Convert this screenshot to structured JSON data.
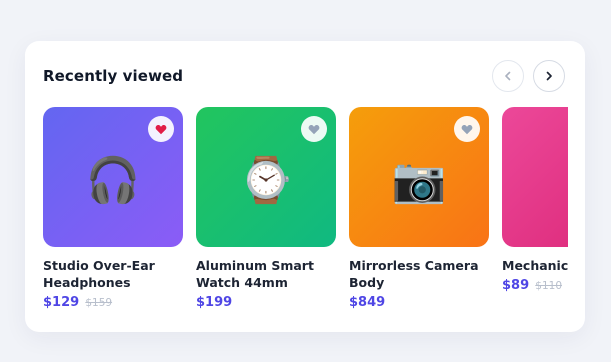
{
  "section": {
    "title": "Recently viewed",
    "prev_icon": "chevron-left-icon",
    "next_icon": "chevron-right-icon"
  },
  "colors": {
    "price": "#4f46e5",
    "old_price": "#b8bfcc",
    "favorite_active": "#e11d48",
    "favorite_inactive": "#94a3b8"
  },
  "products": [
    {
      "name": "Studio Over-Ear Headphones",
      "price": "$129",
      "old_price": "$159",
      "icon": "headphones-icon",
      "glyph": "🎧",
      "favorited": true,
      "gradient": [
        "#6366f1",
        "#8b5cf6"
      ]
    },
    {
      "name": "Aluminum Smart Watch 44mm",
      "price": "$199",
      "old_price": "",
      "icon": "watch-icon",
      "glyph": "⌚",
      "favorited": false,
      "gradient": [
        "#22c55e",
        "#10b981"
      ]
    },
    {
      "name": "Mirrorless Camera Body",
      "price": "$849",
      "old_price": "",
      "icon": "camera-icon",
      "glyph": "📷",
      "favorited": false,
      "gradient": [
        "#f59e0b",
        "#f97316"
      ]
    },
    {
      "name": "Mechanica",
      "price": "$89",
      "old_price": "$110",
      "icon": "keyboard-icon",
      "glyph": "⌨️",
      "favorited": false,
      "gradient": [
        "#ec4899",
        "#db2777"
      ]
    }
  ]
}
